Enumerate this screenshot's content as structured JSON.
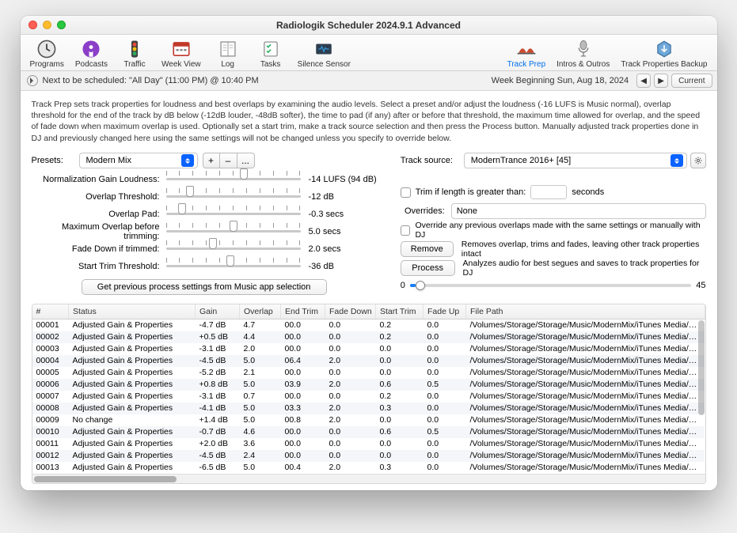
{
  "title": "Radiologik Scheduler 2024.9.1 Advanced",
  "toolbar": [
    {
      "label": "Programs",
      "icon": "clock"
    },
    {
      "label": "Podcasts",
      "icon": "podcast"
    },
    {
      "label": "Traffic",
      "icon": "traffic"
    },
    {
      "label": "Week View",
      "icon": "week"
    },
    {
      "label": "Log",
      "icon": "log"
    },
    {
      "label": "Tasks",
      "icon": "tasks"
    },
    {
      "label": "Silence Sensor",
      "icon": "sensor"
    },
    {
      "label": "Track Prep",
      "icon": "trackprep",
      "active": true
    },
    {
      "label": "Intros & Outros",
      "icon": "mic"
    },
    {
      "label": "Track Properties Backup",
      "icon": "backup"
    }
  ],
  "next_scheduled": "Next to be scheduled: \"All Day\" (11:00 PM) @ 10:40 PM",
  "week_label": "Week Beginning Sun, Aug 18, 2024",
  "current_btn": "Current",
  "description": "Track Prep sets track properties for loudness and best overlaps by examining the audio levels. Select a preset and/or adjust the loudness (-16 LUFS is Music normal), overlap threshold for the end of the track by dB below (-12dB louder, -48dB softer), the time to pad (if any) after or before that threshold, the maximum time allowed for overlap, and the speed of fade down when maximum overlap is used. Optionally set a start trim, make a track source selection and then press the Process button. Manually adjusted track properties done in DJ and previously changed here using the same settings will not be changed unless you specify to override below.",
  "presets_label": "Presets:",
  "preset_selected": "Modern Mix",
  "plus": "+",
  "minus": "–",
  "dots": "...",
  "track_source_label": "Track source:",
  "track_source_selected": "ModernTrance 2016+ [45]",
  "sliders": {
    "loudness": {
      "label": "Normalization Gain Loudness:",
      "value": "-14 LUFS (94 dB)",
      "pos": 58
    },
    "threshold": {
      "label": "Overlap Threshold:",
      "value": "-12 dB",
      "pos": 18
    },
    "pad": {
      "label": "Overlap Pad:",
      "value": "-0.3 secs",
      "pos": 12
    },
    "maxoverlap": {
      "label": "Maximum Overlap before trimming:",
      "value": "5.0 secs",
      "pos": 50
    },
    "fadedown": {
      "label": "Fade Down if trimmed:",
      "value": "2.0 secs",
      "pos": 35
    },
    "starttrim": {
      "label": "Start Trim Threshold:",
      "value": "-36 dB",
      "pos": 48
    }
  },
  "prev_settings_btn": "Get previous process settings from Music app selection",
  "trim_if_label": "Trim if length is greater than:",
  "trim_if_unit": "seconds",
  "trim_if_value": "",
  "overrides_label": "Overrides:",
  "overrides_value": "None",
  "override_prev_label": "Override any previous overlaps made with the same settings or manually with DJ",
  "remove_btn": "Remove",
  "remove_desc": "Removes overlap, trims and fades, leaving other track properties intact",
  "process_btn": "Process",
  "process_desc": "Analyzes audio for best segues and saves to track properties for DJ",
  "progress_start": "0",
  "progress_end": "45",
  "columns": [
    "#",
    "Status",
    "Gain",
    "Overlap",
    "End Trim",
    "Fade Down",
    "Start Trim",
    "Fade Up",
    "File Path"
  ],
  "rows": [
    {
      "n": "00001",
      "status": "Adjusted Gain & Properties",
      "gain": "-4.7 dB",
      "overlap": "4.7",
      "end": "00.0",
      "fd": "0.0",
      "st": "0.2",
      "fu": "0.0",
      "path": "/Volumes/Storage/Storage/Music/ModernMix/iTunes Media/Music/"
    },
    {
      "n": "00002",
      "status": "Adjusted Gain & Properties",
      "gain": "+0.5 dB",
      "overlap": "4.4",
      "end": "00.0",
      "fd": "0.0",
      "st": "0.2",
      "fu": "0.0",
      "path": "/Volumes/Storage/Storage/Music/ModernMix/iTunes Media/Music/"
    },
    {
      "n": "00003",
      "status": "Adjusted Gain & Properties",
      "gain": "-3.1 dB",
      "overlap": "2.0",
      "end": "00.0",
      "fd": "0.0",
      "st": "0.0",
      "fu": "0.0",
      "path": "/Volumes/Storage/Storage/Music/ModernMix/iTunes Media/Music/"
    },
    {
      "n": "00004",
      "status": "Adjusted Gain & Properties",
      "gain": "-4.5 dB",
      "overlap": "5.0",
      "end": "06.4",
      "fd": "2.0",
      "st": "0.0",
      "fu": "0.0",
      "path": "/Volumes/Storage/Storage/Music/ModernMix/iTunes Media/Music/"
    },
    {
      "n": "00005",
      "status": "Adjusted Gain & Properties",
      "gain": "-5.2 dB",
      "overlap": "2.1",
      "end": "00.0",
      "fd": "0.0",
      "st": "0.0",
      "fu": "0.0",
      "path": "/Volumes/Storage/Storage/Music/ModernMix/iTunes Media/Music/"
    },
    {
      "n": "00006",
      "status": "Adjusted Gain & Properties",
      "gain": "+0.8 dB",
      "overlap": "5.0",
      "end": "03.9",
      "fd": "2.0",
      "st": "0.6",
      "fu": "0.5",
      "path": "/Volumes/Storage/Storage/Music/ModernMix/iTunes Media/Music/"
    },
    {
      "n": "00007",
      "status": "Adjusted Gain & Properties",
      "gain": "-3.1 dB",
      "overlap": "0.7",
      "end": "00.0",
      "fd": "0.0",
      "st": "0.2",
      "fu": "0.0",
      "path": "/Volumes/Storage/Storage/Music/ModernMix/iTunes Media/Music/"
    },
    {
      "n": "00008",
      "status": "Adjusted Gain & Properties",
      "gain": "-4.1 dB",
      "overlap": "5.0",
      "end": "03.3",
      "fd": "2.0",
      "st": "0.3",
      "fu": "0.0",
      "path": "/Volumes/Storage/Storage/Music/ModernMix/iTunes Media/Music/"
    },
    {
      "n": "00009",
      "status": "No change",
      "gain": "+1.4 dB",
      "overlap": "5.0",
      "end": "00.8",
      "fd": "2.0",
      "st": "0.0",
      "fu": "0.0",
      "path": "/Volumes/Storage/Storage/Music/ModernMix/iTunes Media/Music/"
    },
    {
      "n": "00010",
      "status": "Adjusted Gain & Properties",
      "gain": "-0.7 dB",
      "overlap": "4.6",
      "end": "00.0",
      "fd": "0.0",
      "st": "0.6",
      "fu": "0.5",
      "path": "/Volumes/Storage/Storage/Music/ModernMix/iTunes Media/Music/"
    },
    {
      "n": "00011",
      "status": "Adjusted Gain & Properties",
      "gain": "+2.0 dB",
      "overlap": "3.6",
      "end": "00.0",
      "fd": "0.0",
      "st": "0.0",
      "fu": "0.0",
      "path": "/Volumes/Storage/Storage/Music/ModernMix/iTunes Media/Music/"
    },
    {
      "n": "00012",
      "status": "Adjusted Gain & Properties",
      "gain": "-4.5 dB",
      "overlap": "2.4",
      "end": "00.0",
      "fd": "0.0",
      "st": "0.0",
      "fu": "0.0",
      "path": "/Volumes/Storage/Storage/Music/ModernMix/iTunes Media/Music/"
    },
    {
      "n": "00013",
      "status": "Adjusted Gain & Properties",
      "gain": "-6.5 dB",
      "overlap": "5.0",
      "end": "00.4",
      "fd": "2.0",
      "st": "0.3",
      "fu": "0.0",
      "path": "/Volumes/Storage/Storage/Music/ModernMix/iTunes Media/Music/"
    }
  ]
}
